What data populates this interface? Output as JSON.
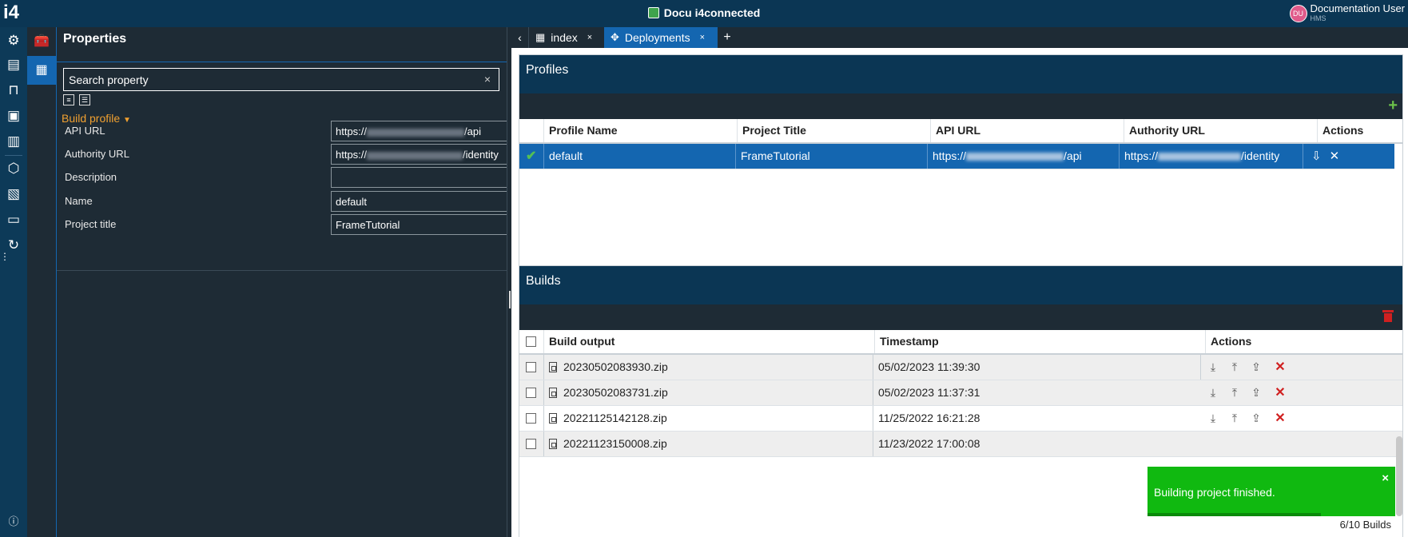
{
  "app": {
    "logo": "i4",
    "title": "Docu i4connected"
  },
  "user": {
    "initials": "DU",
    "name": "Documentation User",
    "org": "HMS"
  },
  "properties": {
    "title": "Properties",
    "search_placeholder": "Search property",
    "clear": "×",
    "section": "Build profile",
    "fields": [
      {
        "label": "API URL",
        "prefix": "https://",
        "suffix": "/api"
      },
      {
        "label": "Authority URL",
        "prefix": "https://",
        "suffix": "/identity"
      },
      {
        "label": "Description",
        "value": ""
      },
      {
        "label": "Name",
        "value": "default"
      },
      {
        "label": "Project title",
        "value": "FrameTutorial"
      }
    ]
  },
  "tabs": {
    "back": "‹",
    "items": [
      {
        "label": "index",
        "icon": "grid-icon",
        "close": "×"
      },
      {
        "label": "Deployments",
        "icon": "crosshair-icon",
        "close": "×"
      }
    ],
    "add": "+"
  },
  "profiles": {
    "title": "Profiles",
    "add": "+",
    "columns": [
      "Profile Name",
      "Project Title",
      "API URL",
      "Authority URL",
      "Actions"
    ],
    "rows": [
      {
        "profile_name": "default",
        "project_title": "FrameTutorial",
        "api_prefix": "https://",
        "api_suffix": "/api",
        "auth_prefix": "https://",
        "auth_suffix": "/identity"
      }
    ]
  },
  "builds": {
    "title": "Builds",
    "columns": [
      "Build output",
      "Timestamp",
      "Actions"
    ],
    "rows": [
      {
        "file": "20230502083930.zip",
        "timestamp": "05/02/2023 11:39:30"
      },
      {
        "file": "20230502083731.zip",
        "timestamp": "05/02/2023 11:37:31"
      },
      {
        "file": "20221125142128.zip",
        "timestamp": "11/25/2022 16:21:28"
      },
      {
        "file": "20221123150008.zip",
        "timestamp": "11/23/2022 17:00:08"
      }
    ],
    "count": "6/10 Builds"
  },
  "toast": {
    "message": "Building project finished.",
    "close": "×",
    "progress": 0.7
  },
  "colors": {
    "titlebar": "#0b3654",
    "accent": "#1466b0",
    "section": "#f0a030",
    "toast": "#10b910",
    "danger": "#d02020"
  }
}
